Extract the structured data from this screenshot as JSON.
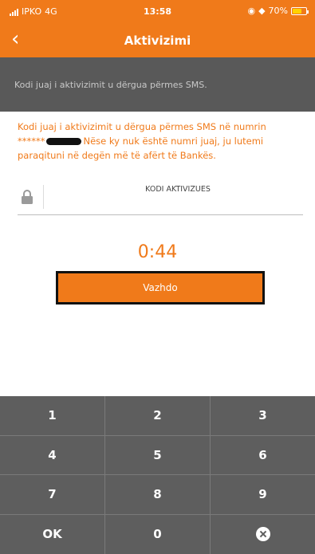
{
  "status_bar": {
    "carrier": "IPKO",
    "network": "4G",
    "time": "13:58",
    "battery_percent": "70%",
    "battery_level": 0.7
  },
  "nav": {
    "back_icon": "chevron-left-icon",
    "title": "Aktivizimi"
  },
  "info": {
    "text": "Kodi juaj i aktivizimit u dërgua përmes SMS."
  },
  "message": {
    "line1": "Kodi juaj i aktivizimit u dërgua përmes SMS në numrin",
    "masked_prefix": "******",
    "line2_rest": "Nëse ky nuk është numri juaj, ju lutemi",
    "line3": "paraqituni në degën më të afërt të Bankës."
  },
  "code_field": {
    "label": "KODI AKTIVIZUES",
    "value": "",
    "icon": "lock-icon"
  },
  "timer": "0:44",
  "continue_button": "Vazhdo",
  "keypad": {
    "keys": [
      "1",
      "2",
      "3",
      "4",
      "5",
      "6",
      "7",
      "8",
      "9",
      "OK",
      "0"
    ],
    "delete_icon": "backspace-icon"
  },
  "colors": {
    "accent": "#f07a1a",
    "info_bar": "#595959",
    "keypad": "#5e5e5e"
  }
}
